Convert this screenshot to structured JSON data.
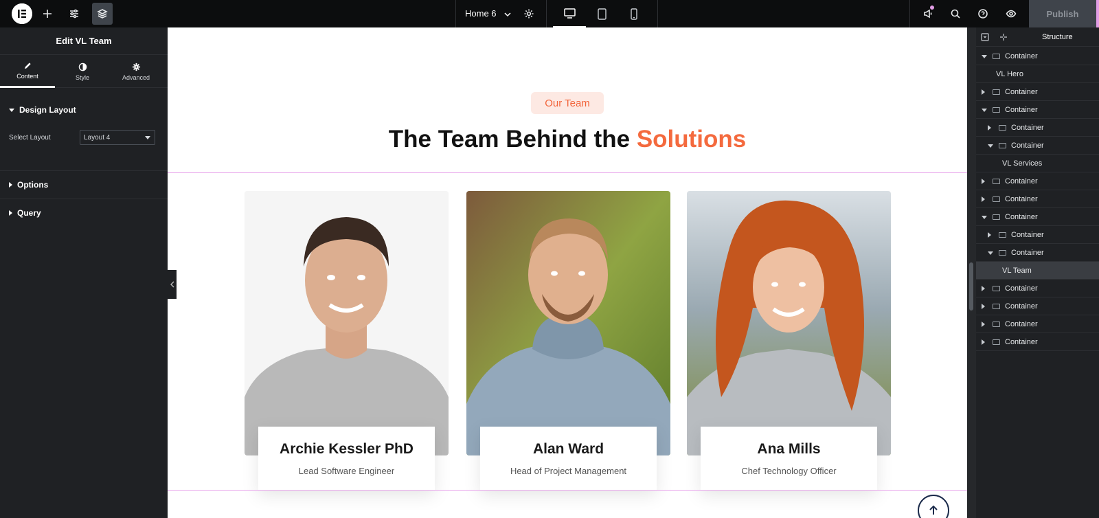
{
  "topbar": {
    "page_name": "Home 6",
    "publish_label": "Publish"
  },
  "left_panel": {
    "title": "Edit VL Team",
    "tabs": [
      {
        "label": "Content",
        "icon": "pencil-icon",
        "active": true
      },
      {
        "label": "Style",
        "icon": "half-circle-icon",
        "active": false
      },
      {
        "label": "Advanced",
        "icon": "gear-icon",
        "active": false
      }
    ],
    "design_layout": {
      "heading": "Design Layout",
      "select_label": "Select Layout",
      "select_value": "Layout 4"
    },
    "options_heading": "Options",
    "query_heading": "Query"
  },
  "canvas": {
    "badge": "Our Team",
    "heading_main": "The Team Behind the ",
    "heading_accent": "Solutions",
    "accent_color": "#f46a3e",
    "members": [
      {
        "name": "Archie Kessler PhD",
        "role": "Lead Software Engineer"
      },
      {
        "name": "Alan Ward",
        "role": "Head of Project Management"
      },
      {
        "name": "Ana Mills",
        "role": "Chef Technology Officer"
      }
    ]
  },
  "structure": {
    "title": "Structure",
    "items": [
      {
        "label": "Container",
        "level": 0,
        "caret": "down"
      },
      {
        "label": "VL Hero",
        "level": 1,
        "caret": "none"
      },
      {
        "label": "Container",
        "level": 0,
        "caret": "right"
      },
      {
        "label": "Container",
        "level": 0,
        "caret": "down"
      },
      {
        "label": "Container",
        "level": 1,
        "caret": "right"
      },
      {
        "label": "Container",
        "level": 1,
        "caret": "down"
      },
      {
        "label": "VL Services",
        "level": 2,
        "caret": "none"
      },
      {
        "label": "Container",
        "level": 0,
        "caret": "right"
      },
      {
        "label": "Container",
        "level": 0,
        "caret": "right"
      },
      {
        "label": "Container",
        "level": 0,
        "caret": "down"
      },
      {
        "label": "Container",
        "level": 1,
        "caret": "right"
      },
      {
        "label": "Container",
        "level": 1,
        "caret": "down"
      },
      {
        "label": "VL Team",
        "level": 2,
        "caret": "none",
        "active": true
      },
      {
        "label": "Container",
        "level": 0,
        "caret": "right"
      },
      {
        "label": "Container",
        "level": 0,
        "caret": "right"
      },
      {
        "label": "Container",
        "level": 0,
        "caret": "right"
      },
      {
        "label": "Container",
        "level": 0,
        "caret": "right"
      }
    ]
  }
}
